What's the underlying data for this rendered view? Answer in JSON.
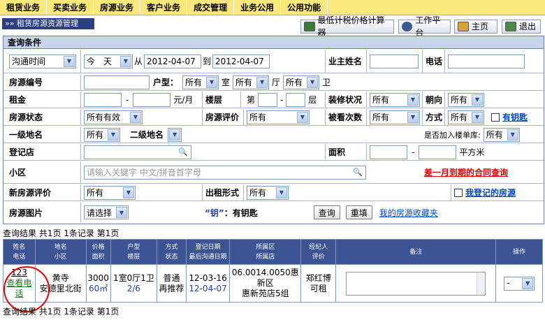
{
  "topnav": [
    "租赁业务",
    "买卖业务",
    "房源业务",
    "客户业务",
    "成交管理",
    "业务公用",
    "公用功能"
  ],
  "page_title": "»» 租赁房源资源管理",
  "toolbar": {
    "calc": "最低计税价格计算器",
    "workbench": "工作平台",
    "home": "主页",
    "logout": "退出"
  },
  "query": {
    "header": "查询条件",
    "time_select": "沟通时间",
    "day_select": "今　天",
    "from_label": "从",
    "date_from": "2012-04-07",
    "to_label": "到",
    "date_to": "2012-04-07",
    "owner_label": "业主姓名",
    "phone_label": "电话",
    "house_no_label": "房源编号",
    "layout_label": "户型：",
    "room_sel": "所有",
    "room_unit": "室",
    "hall_sel": "所有",
    "hall_unit": "厅",
    "bath_sel": "所有",
    "bath_unit": "卫",
    "rent_label": "租金",
    "dash": "-",
    "rent_unit": "元/月",
    "floor_label": "楼层",
    "floor_prefix": "第",
    "floor_unit": "层",
    "decor_label": "装修状况",
    "decor_sel": "所有",
    "orient_label": "朝向",
    "orient_sel": "所有",
    "status_label": "房源状态",
    "status_sel": "所有有效",
    "eval_label": "房源评价",
    "eval_sel": "所有",
    "viewed_label": "被看次数",
    "viewed_sel": "所有",
    "method_label": "方式",
    "method_sel": "所有",
    "key_link": "有钥匙",
    "area1_label": "一级地名",
    "area1_sel": "所有",
    "area2_label": "二级地名",
    "building_label": "是否加入楼单库:",
    "building_sel": "所有",
    "store_label": "登记店",
    "area_label": "面积",
    "area_unit": "平方米",
    "community_label": "小区",
    "community_placeholder": "请输入关键字 中文/拼音首字母",
    "expire_link": "差一月到期的合同查询",
    "new_eval_label": "新房源评价",
    "new_eval_sel": "所有",
    "rent_type_label": "出租形式",
    "rent_type_sel": "所有",
    "my_reg_link": "我登记的房源",
    "photo_label": "房源图片",
    "photo_sel": "请选择",
    "key_note_quote": "“钥”",
    "key_note": "：有钥匙",
    "search_btn": "查询",
    "reset_btn": "重填",
    "fav_link": "我的房源收藏夹"
  },
  "summary": "查询结果 共1页 1条记录 第1页",
  "table": {
    "headers": [
      [
        "姓名",
        "电话"
      ],
      [
        "地名",
        "小区"
      ],
      [
        "价格",
        "面积"
      ],
      [
        "户型",
        "楼层"
      ],
      [
        "方式",
        "状态"
      ],
      [
        "登记日期",
        "最后沟通日期"
      ],
      [
        "所属区",
        "所属店"
      ],
      [
        "经纪人",
        "评价"
      ],
      [
        "备注",
        ""
      ],
      [
        "操作",
        ""
      ]
    ],
    "row": {
      "name": "123",
      "phone_link": "查看电话",
      "place": "黄寺",
      "community": "安德里北街",
      "price": "3000",
      "area": "60㎡",
      "layout": "1室0厅1卫",
      "floor": "2/6",
      "method": "普通",
      "status": "再推荐",
      "reg_date": "12-03-16",
      "last_date": "12-04-07",
      "district": "06.0014.0050惠新区",
      "store": "惠新苑店5组",
      "agent": "郑红博",
      "rating": "可租",
      "action_sel": "-"
    }
  }
}
